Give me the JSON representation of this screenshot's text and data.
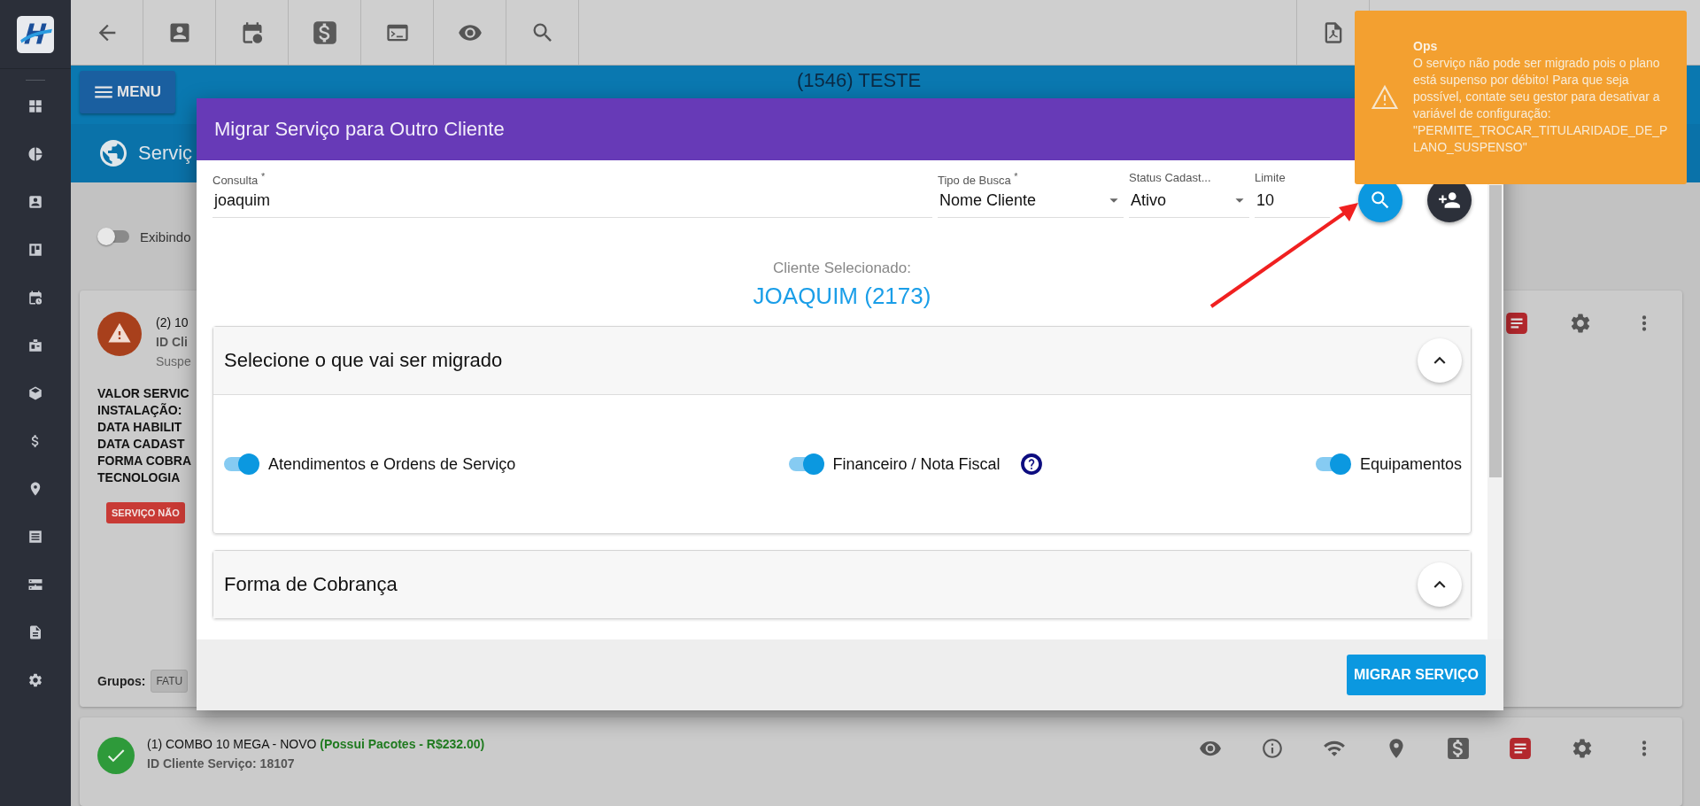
{
  "header": {
    "menu_button": "MENU",
    "title": "(1546) TESTE",
    "section_title": "Serviç"
  },
  "filter": {
    "toggle_label": "Exibindo",
    "on": false
  },
  "services": [
    {
      "kind": "warning",
      "title": "(2) 10",
      "id_line": "ID Cli",
      "status_text": "Suspe",
      "details": [
        "VALOR SERVIC",
        "INSTALAÇÃO:",
        "DATA HABILIT",
        "DATA CADAST",
        "FORMA COBRA",
        "TECNOLOGIA"
      ],
      "badge": "SERVIÇO NÃO",
      "groups_label": "Grupos:",
      "group_chip": "FATU"
    },
    {
      "kind": "ok",
      "title": "(1) COMBO 10 MEGA - NOVO",
      "title_extra": "(Possui Pacotes - R$232.00)",
      "id_line": "ID Cliente Serviço: 18107"
    }
  ],
  "modal": {
    "title": "Migrar Serviço para Outro Cliente",
    "fields": [
      {
        "label": "Consulta $^{*}$",
        "value": "joaquim",
        "kind": "text"
      },
      {
        "label": "Tipo de Busca $^{*}$",
        "value": "Nome Cliente",
        "kind": "select"
      },
      {
        "label": "Status Cadast...",
        "value": "Ativo",
        "kind": "select"
      },
      {
        "label": "Limite",
        "value": "10",
        "kind": "text"
      }
    ],
    "selected_label": "Cliente Selecionado:",
    "selected_client": "JOAQUIM (2173)",
    "panels": [
      {
        "title": "Selecione o que vai ser migrado",
        "expanded": true,
        "options": [
          {
            "label": "Atendimentos e Ordens de Serviço",
            "checked": true,
            "help": false
          },
          {
            "label": "Financeiro / Nota Fiscal",
            "checked": true,
            "help": true
          },
          {
            "label": "Equipamentos",
            "checked": true,
            "help": false
          }
        ]
      },
      {
        "title": "Forma de Cobrança",
        "expanded": true
      }
    ],
    "submit": "MIGRAR SERVIÇO"
  },
  "toast": {
    "title": "Ops",
    "message": "O serviço não pode ser migrado pois o plano está supenso por débito! Para que seja possível, contate seu gestor para desativar a variável de configuração: \"PERMITE_TROCAR_TITULARIDADE_DE_PLANO_SUSPENSO\""
  }
}
